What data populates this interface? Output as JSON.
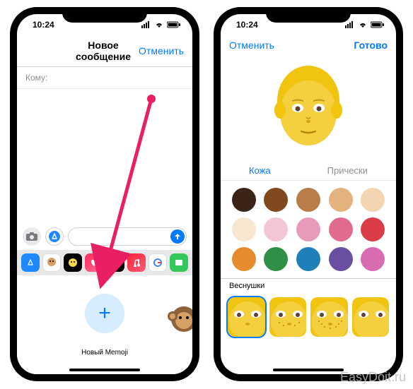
{
  "statusbar": {
    "time": "10:24"
  },
  "phone1": {
    "header": {
      "title": "Новое сообщение",
      "cancel": "Отменить"
    },
    "to_label": "Кому:",
    "memoji": {
      "new_label": "Новый Memoji"
    }
  },
  "phone2": {
    "header": {
      "cancel": "Отменить",
      "done": "Готово"
    },
    "tabs": {
      "skin": "Кожа",
      "hair": "Прически"
    },
    "swatches": [
      "#3a2416",
      "#81471e",
      "#b97d4a",
      "#e3b27f",
      "#f3d6b1",
      "#f7e7d0",
      "#f3c6d3",
      "#e89abb",
      "#e16a8d",
      "#da3c48",
      "#e78b2f",
      "#2f8f46",
      "#1f7fb8",
      "#6a4ea1",
      "#d96bb0"
    ],
    "freckles_label": "Веснушки"
  },
  "watermark": "EasyDoit.ru",
  "icons": {
    "camera": "camera",
    "appstore": "appstore",
    "heart": "heart",
    "apay": "apay",
    "music": "music",
    "google": "google",
    "memoji": "memoji",
    "images": "images"
  }
}
